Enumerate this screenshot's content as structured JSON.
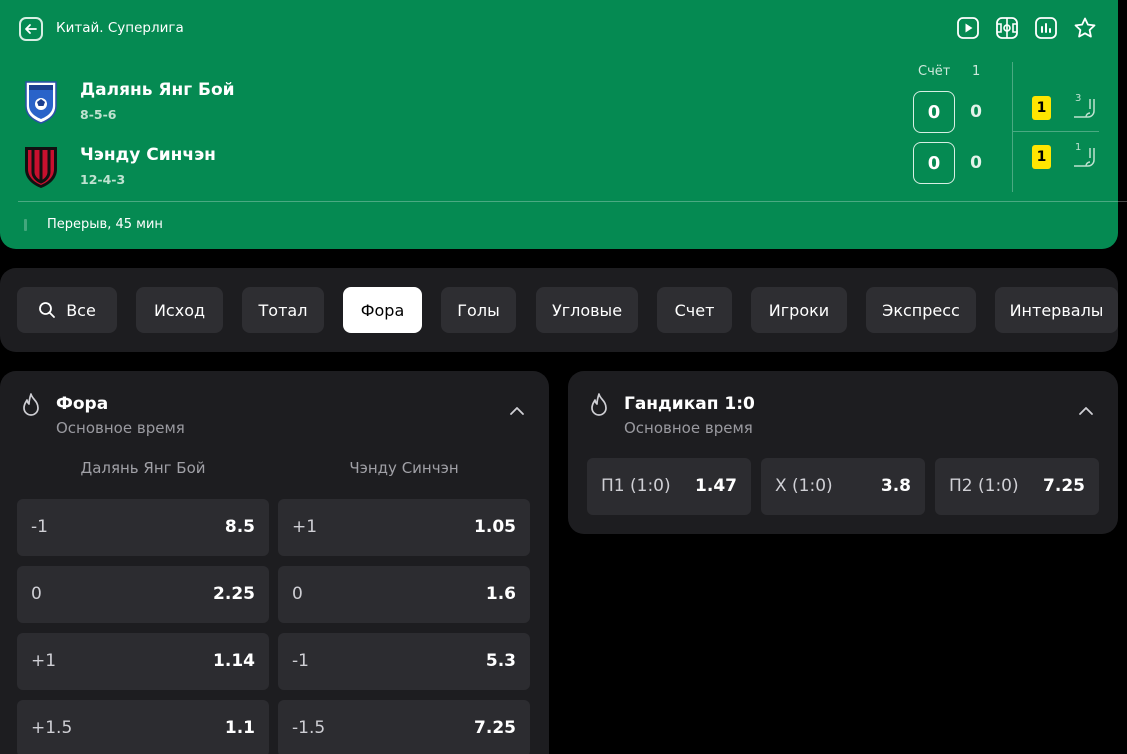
{
  "header": {
    "league": "Китай. Суперлига",
    "icons": [
      "play-icon",
      "field-icon",
      "stats-icon",
      "star-icon"
    ],
    "score_label": "Счёт",
    "period_label": "1",
    "status": "Перерыв, 45 мин",
    "teams": [
      {
        "name": "Далянь Янг Бой",
        "record": "8-5-6",
        "score": "0",
        "period_score": "0",
        "yellow_cards": "1",
        "corners": "3"
      },
      {
        "name": "Чэнду Синчэн",
        "record": "12-4-3",
        "score": "0",
        "period_score": "0",
        "yellow_cards": "1",
        "corners": "1"
      }
    ]
  },
  "filters": {
    "search_icon": "search-icon",
    "items": [
      "Все",
      "Исход",
      "Тотал",
      "Фора",
      "Голы",
      "Угловые",
      "Счет",
      "Игроки",
      "Экспресс",
      "Интервалы"
    ],
    "active": "Фора"
  },
  "handicap": {
    "title": "Фора",
    "subtitle": "Основное время",
    "col1": "Далянь Янг Бой",
    "col2": "Чэнду Синчэн",
    "rows": [
      {
        "l_label": "-1",
        "l_value": "8.5",
        "r_label": "+1",
        "r_value": "1.05"
      },
      {
        "l_label": "0",
        "l_value": "2.25",
        "r_label": "0",
        "r_value": "1.6"
      },
      {
        "l_label": "+1",
        "l_value": "1.14",
        "r_label": "-1",
        "r_value": "5.3"
      },
      {
        "l_label": "+1.5",
        "l_value": "1.1",
        "r_label": "-1.5",
        "r_value": "7.25"
      }
    ]
  },
  "gandicap": {
    "title": "Гандикап 1:0",
    "subtitle": "Основное время",
    "odds": [
      {
        "label": "П1 (1:0)",
        "value": "1.47"
      },
      {
        "label": "Х (1:0)",
        "value": "3.8"
      },
      {
        "label": "П2 (1:0)",
        "value": "7.25"
      }
    ]
  },
  "colors": {
    "header_bg": "#058a52",
    "panel_bg": "#1d1d20",
    "cell_bg": "#2c2c30",
    "yellow_card": "#ffe500"
  }
}
